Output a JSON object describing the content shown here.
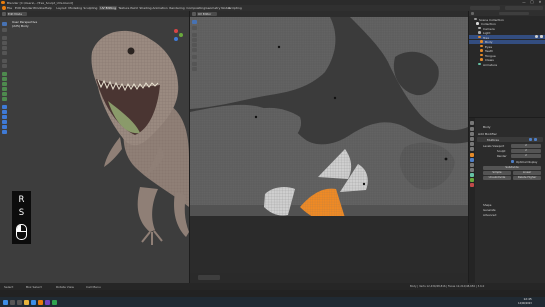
{
  "window": {
    "title": "Blender [C:\\Users\\...\\Trex_Sculpt_UVs.blend]",
    "controls": [
      "—",
      "□",
      "✕"
    ]
  },
  "menubar": {
    "menus": [
      "File",
      "Edit",
      "Render",
      "Window",
      "Help"
    ],
    "workspaces": [
      "Layout",
      "Modeling",
      "Sculpting",
      "UV Editing",
      "Texture Paint",
      "Shading",
      "Animation",
      "Rendering",
      "Compositing",
      "Geometry Nodes",
      "Scripting"
    ],
    "active_workspace": "UV Editing"
  },
  "viewport3d": {
    "mode": "Edit Mode",
    "info_lines": [
      "User Perspective",
      "(225) Body"
    ],
    "keys_shown": [
      "R",
      "S"
    ]
  },
  "uv_editor": {
    "mode": "UV Editor"
  },
  "outliner": {
    "title": "Scene Collection",
    "items": [
      {
        "label": "Scene Collection",
        "color": "#9a9a9a",
        "selected": false
      },
      {
        "label": "Collection",
        "color": "#d9d9d9",
        "selected": false
      },
      {
        "label": "Camera",
        "color": "#b0b0b0",
        "selected": false
      },
      {
        "label": "Light",
        "color": "#b0b0b0",
        "selected": false
      },
      {
        "label": "Trex",
        "color": "#e48a2a",
        "selected": true
      },
      {
        "label": "Body",
        "color": "#e48a2a",
        "selected": true
      },
      {
        "label": "Eyes",
        "color": "#e48a2a",
        "selected": false
      },
      {
        "label": "Teeth",
        "color": "#e48a2a",
        "selected": false
      },
      {
        "label": "Tongue",
        "color": "#e48a2a",
        "selected": false
      },
      {
        "label": "Claws",
        "color": "#e48a2a",
        "selected": false
      },
      {
        "label": "Armature",
        "color": "#66c2a5",
        "selected": false
      }
    ]
  },
  "properties": {
    "object_name": "Body",
    "section": "Add Modifier",
    "modifier_name": "Multires",
    "rows": [
      "Levels Viewport",
      "Sculpt",
      "Render",
      "Optimal Display"
    ],
    "values": [
      "2",
      "2",
      "2"
    ],
    "buttons": [
      "Subdivide",
      "Simple",
      "Linear",
      "Unsubdivide",
      "Delete Higher"
    ],
    "subsections": [
      "Shape",
      "Generate",
      "Advanced"
    ]
  },
  "statusbar": {
    "items": [
      "Select",
      "Box Select",
      "Rotate View",
      "Call Menu"
    ],
    "right": "Body | Verts 12,430/48,816 | Faces 12,212/48,650 | 3.6.0"
  },
  "taskbar": {
    "time": "12:45",
    "date": "14/06/2023"
  },
  "colors": {
    "selected_island": "#f08a24",
    "uv_grid": "#6e6e6e",
    "accent": "#4772b3"
  }
}
